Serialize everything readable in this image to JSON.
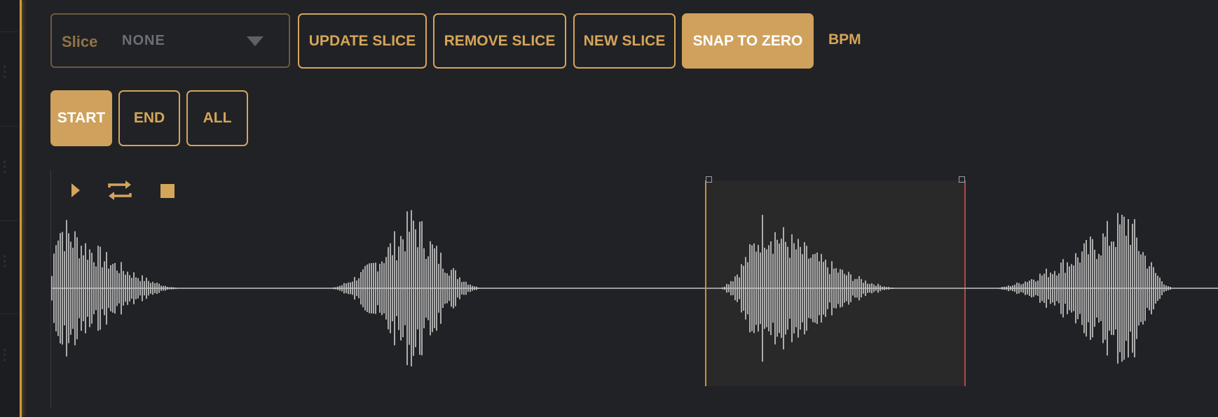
{
  "toolbar": {
    "slice_label": "Slice",
    "slice_value": "NONE",
    "update_slice": "UPDATE SLICE",
    "remove_slice": "REMOVE SLICE",
    "new_slice": "NEW SLICE",
    "snap_to_zero": "SNAP TO ZERO",
    "bpm": "BPM"
  },
  "mode": {
    "start": "START",
    "end": "END",
    "all": "ALL",
    "active": "START"
  },
  "transport": {
    "play_icon": "play-icon",
    "loop_icon": "loop-icon",
    "stop_icon": "stop-icon"
  },
  "colors": {
    "accent": "#d5a559",
    "accent_fill": "#cfa15c",
    "background": "#212225",
    "waveform": "#bfbfbf",
    "selection_start": "#c9903a",
    "selection_end": "#b3474a"
  }
}
